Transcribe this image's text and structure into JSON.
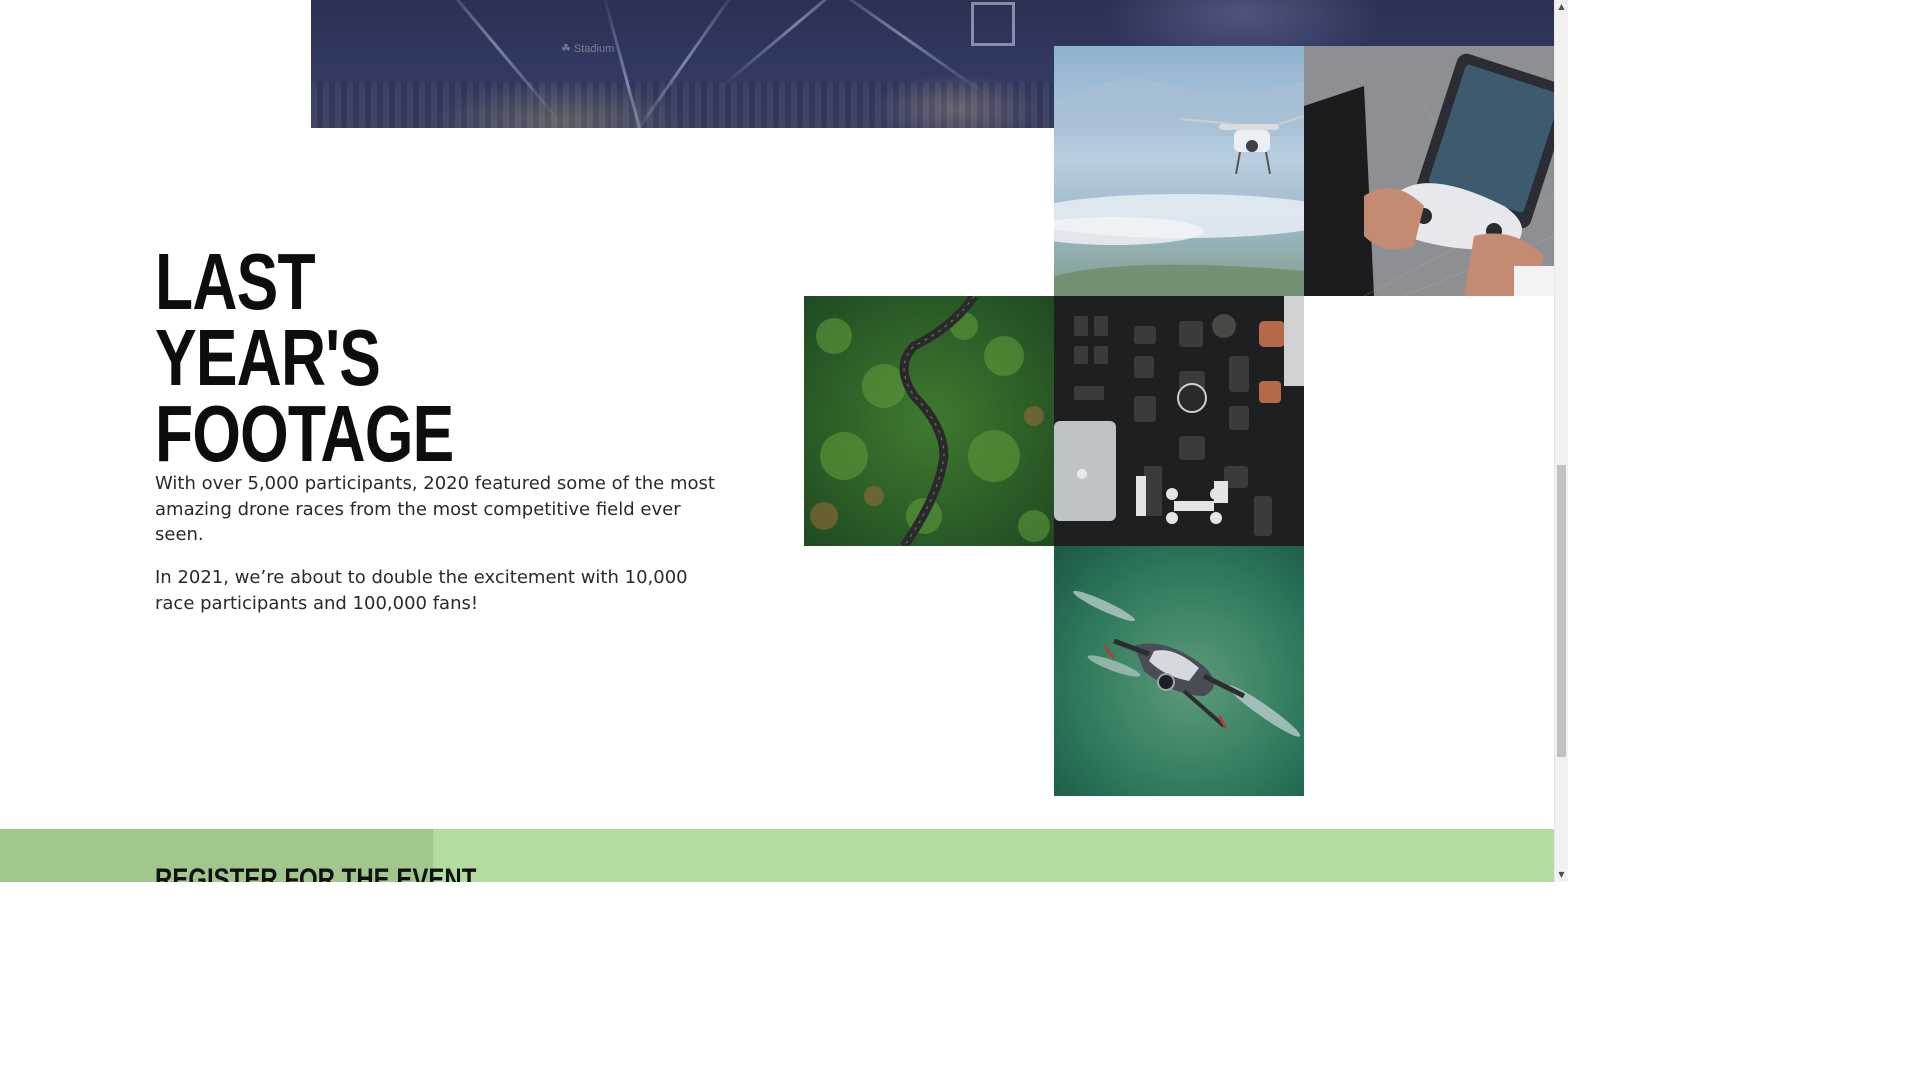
{
  "section": {
    "title_line1": "LAST YEAR'S",
    "title_line2": "FOOTAGE",
    "paragraph1": "With over 5,000 participants, 2020 featured some of the most amazing drone races from the most competitive field ever seen.",
    "paragraph2": "In 2021, we’re about to double the excitement with 10,000 race participants and 100,000 fans!"
  },
  "hero": {
    "sponsor_text": "☘ Stadium"
  },
  "gallery": {
    "images": [
      {
        "name": "drone-over-clouds-photo"
      },
      {
        "name": "hands-holding-controller-photo"
      },
      {
        "name": "winding-forest-road-photo"
      },
      {
        "name": "camera-gear-flatlay-photo"
      },
      {
        "name": "drone-green-background-photo"
      }
    ]
  },
  "register": {
    "title": "REGISTER FOR THE EVENT"
  },
  "scrollbar": {
    "up_glyph": "▲",
    "down_glyph": "▼"
  },
  "colors": {
    "register_band": "#b3dd9f",
    "register_left": "#a2c78d",
    "hero_band": "#2f3860",
    "text": "#2a2a2a"
  }
}
